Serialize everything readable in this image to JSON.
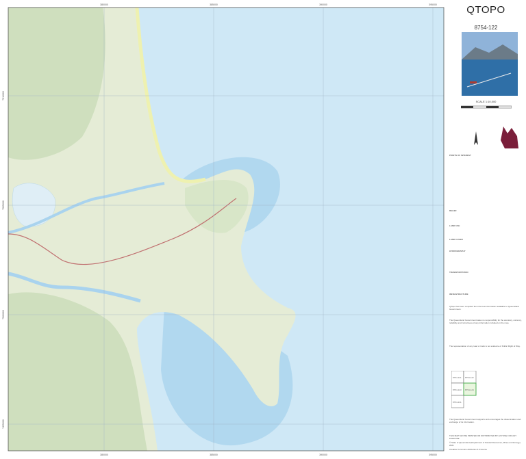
{
  "map": {
    "grid_top_labels": [
      "380000",
      "385000",
      "390000",
      "395000",
      "400000"
    ],
    "grid_bottom_labels": [
      "380000",
      "385000",
      "390000",
      "395000",
      "400000"
    ],
    "grid_left_labels": [
      "7510000",
      "7505000",
      "7500000",
      "7495000"
    ],
    "colors": {
      "sea": "#cfe8f6",
      "deep_sea": "#a9d3ee",
      "land": "#e5ecd6",
      "vegetation": "#cfdfbe",
      "beach": "#eef1b0",
      "road": "#c07070"
    }
  },
  "legend_panel": {
    "title": "QTOPO",
    "sheet_number": "8754-122",
    "scale": "SCALE 1:10,000",
    "legend_heading": "POINTS OF INTEREST",
    "sections": [
      "RELIEF",
      "LAND USE",
      "LAND COVER",
      "HYDROGRAPHY",
      "TRANSPORTATION",
      "INFRASTRUCTURE"
    ],
    "disclaimer_1": "QTopo has been compiled from the best information available to Queensland Government.",
    "disclaimer_2": "The Queensland Government takes no responsibility for the accuracy, currency, reliability and correctness of any information included on the map.",
    "disclaimer_3": "The representation of any road or track is not evidence of Public Right of Way.",
    "index_sheets": [
      "8754-121",
      "8754-122",
      "8754-123",
      "8754-124",
      "8754-131"
    ],
    "footer_1": "The Queensland Government supports and encourages the dissemination and exchange of its information.",
    "footer_2": "THIS MAP MAY BE PRINTED OR DISTRIBUTED BY ANYONE FOR ANY PURPOSE",
    "copyright": "© State of Queensland (Department of Natural Resources, Mines and Energy) 2021",
    "license": "Creative Commons Attribution 4.0 licence"
  }
}
